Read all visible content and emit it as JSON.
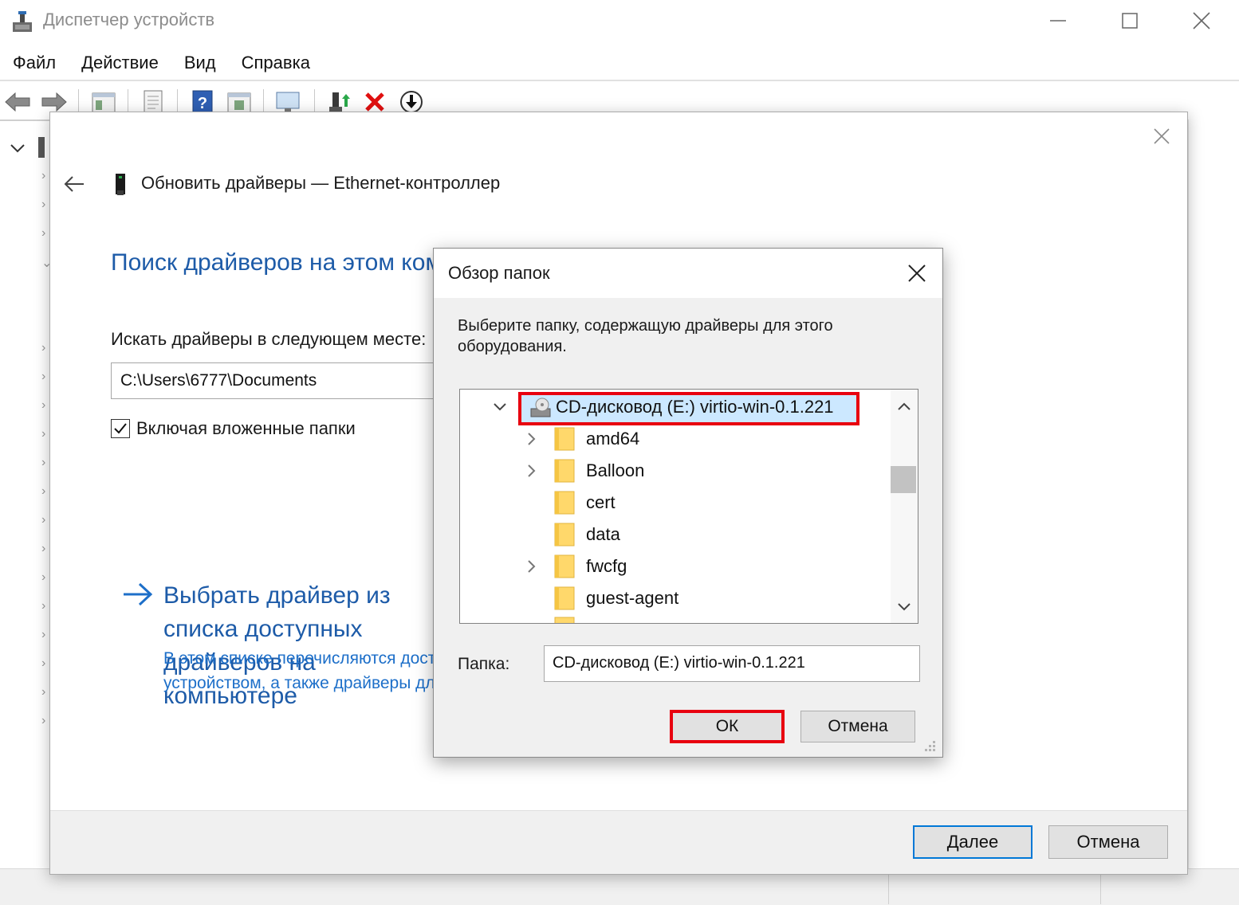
{
  "device_manager": {
    "title": "Диспетчер устройств",
    "menu": [
      "Файл",
      "Действие",
      "Вид",
      "Справка"
    ],
    "toolbar_icons": [
      "back-arrow-icon",
      "forward-arrow-icon",
      "show-hide-tree-icon",
      "properties-icon",
      "help-icon",
      "view-icon",
      "monitor-icon",
      "update-driver-icon",
      "uninstall-icon",
      "scan-changes-icon"
    ]
  },
  "wizard": {
    "title": "Обновить драйверы — Ethernet-контроллер",
    "heading": "Поиск драйверов на этом компьютере",
    "search_label": "Искать драйверы в следующем месте:",
    "path_value": "C:\\Users\\6777\\Documents",
    "include_subfolders_label": "Включая вложенные папки",
    "include_subfolders_checked": true,
    "pick_title": "Выбрать драйвер из списка доступных драйверов на компьютере",
    "pick_desc_line1": "В этом списке перечисляются доступные драйверы, совместимые с данным",
    "pick_desc_line2": "устройством, а также драйверы для устройств той же категории.",
    "next_label": "Далее",
    "cancel_label": "Отмена"
  },
  "browse": {
    "title": "Обзор папок",
    "description": "Выберите папку, содержащую драйверы для этого оборудования.",
    "tree": {
      "drive_label": "CD-дисковод (E:) virtio-win-0.1.221",
      "folders": [
        {
          "name": "amd64",
          "expandable": true
        },
        {
          "name": "Balloon",
          "expandable": true
        },
        {
          "name": "cert",
          "expandable": false
        },
        {
          "name": "data",
          "expandable": false
        },
        {
          "name": "fwcfg",
          "expandable": true
        },
        {
          "name": "guest-agent",
          "expandable": false
        }
      ]
    },
    "folder_label": "Папка:",
    "folder_value": "CD-дисковод (E:) virtio-win-0.1.221",
    "ok_label": "ОК",
    "cancel_label": "Отмена"
  },
  "colors": {
    "link_blue": "#1d5ba8",
    "highlight_red": "#e8000f",
    "selection": "#cce8ff"
  }
}
